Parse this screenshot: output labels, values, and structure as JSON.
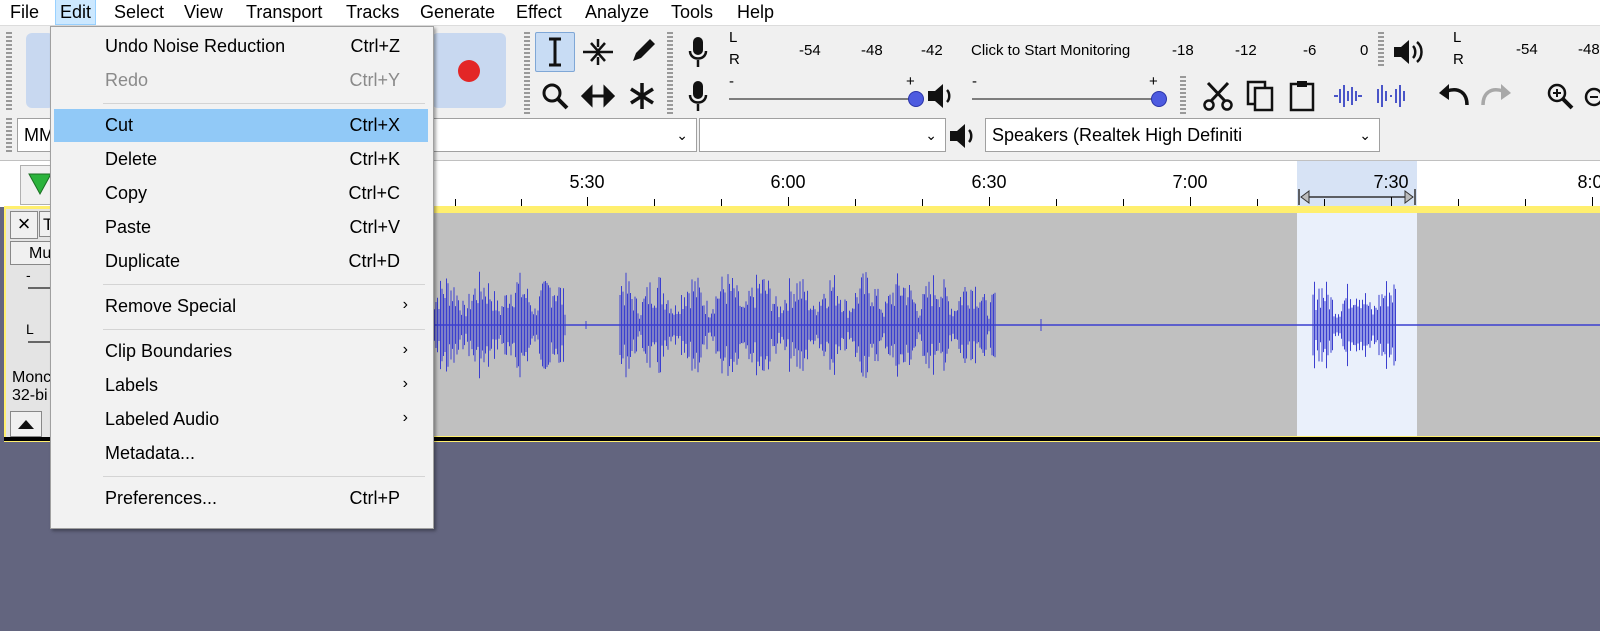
{
  "menubar": {
    "items": [
      "File",
      "Edit",
      "Select",
      "View",
      "Transport",
      "Tracks",
      "Generate",
      "Effect",
      "Analyze",
      "Tools",
      "Help"
    ],
    "active": "Edit"
  },
  "meter": {
    "rec_L": "L",
    "rec_R": "R",
    "rec_ticks": [
      "-54",
      "-48",
      "-42",
      "-18",
      "-12",
      "-6",
      "0"
    ],
    "click_to_monitor": "Click to Start Monitoring",
    "play_L": "L",
    "play_R": "R",
    "play_ticks": [
      "-54",
      "-48"
    ]
  },
  "sliders": {
    "rec_minus": "-",
    "rec_plus": "+",
    "play_minus": "-",
    "play_plus": "+"
  },
  "device": {
    "host_prefix": "MM",
    "output_device": "Speakers (Realtek High Definiti"
  },
  "ruler": {
    "labels": [
      "5:30",
      "6:00",
      "6:30",
      "7:00",
      "7:30",
      "8:0"
    ]
  },
  "track": {
    "close": "×",
    "name_prefix": "T",
    "mute_prefix": "Mu",
    "gain_minus": "-",
    "pan_left": "L",
    "info_line1": "Monc",
    "info_line2": "32-bi"
  },
  "edit_menu": {
    "items": [
      {
        "label": "Undo Noise Reduction",
        "shortcut": "Ctrl+Z"
      },
      {
        "label": "Redo",
        "shortcut": "Ctrl+Y"
      },
      {
        "label": "Cut",
        "shortcut": "Ctrl+X"
      },
      {
        "label": "Delete",
        "shortcut": "Ctrl+K"
      },
      {
        "label": "Copy",
        "shortcut": "Ctrl+C"
      },
      {
        "label": "Paste",
        "shortcut": "Ctrl+V"
      },
      {
        "label": "Duplicate",
        "shortcut": "Ctrl+D"
      },
      {
        "label": "Remove Special",
        "submenu": "›"
      },
      {
        "label": "Clip Boundaries",
        "submenu": "›"
      },
      {
        "label": "Labels",
        "submenu": "›"
      },
      {
        "label": "Labeled Audio",
        "submenu": "›"
      },
      {
        "label": "Metadata..."
      },
      {
        "label": "Preferences...",
        "shortcut": "Ctrl+P"
      }
    ]
  },
  "colors": {
    "waveform": "#3b3fcf",
    "selection": "#eaf0fb",
    "menu_hover": "#91c9f7",
    "track_border": "#ffef6e",
    "record_dot": "#e32626"
  }
}
